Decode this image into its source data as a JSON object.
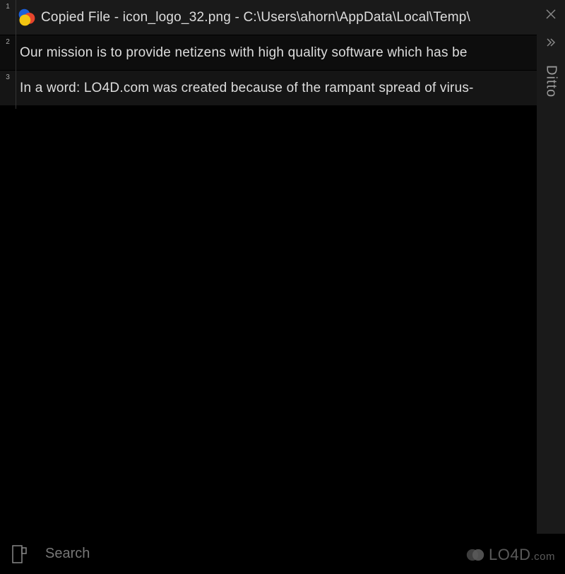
{
  "app": {
    "name": "Ditto"
  },
  "clips": [
    {
      "index": "1",
      "has_icon": true,
      "text": "Copied File - icon_logo_32.png - C:\\Users\\ahorn\\AppData\\Local\\Temp\\",
      "selected": true
    },
    {
      "index": "2",
      "has_icon": false,
      "text": "Our mission is to provide netizens with high quality software which has be",
      "selected": false
    },
    {
      "index": "3",
      "has_icon": false,
      "text": "In a word: LO4D.com was created because of the rampant spread of virus-",
      "selected": false
    }
  ],
  "side": {
    "close": "close",
    "expand": "expand"
  },
  "search": {
    "placeholder": "Search",
    "value": ""
  },
  "watermark": {
    "brand": "LO4D",
    "suffix": ".com"
  }
}
